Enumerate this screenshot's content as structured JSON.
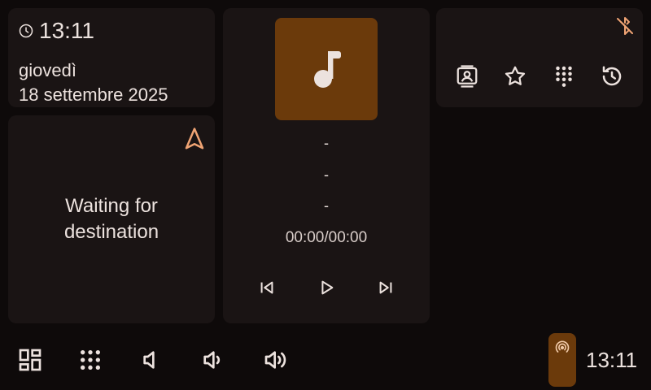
{
  "clock_widget": {
    "time": "13:11",
    "day": "giovedì",
    "date": "18 settembre 2025",
    "icon": "clock-icon"
  },
  "navigation": {
    "message": "Waiting for destination",
    "icon": "navigation-arrow-icon",
    "accent": "#f0a474"
  },
  "media": {
    "title": "-",
    "artist": "-",
    "album": "-",
    "time": "00:00/00:00",
    "art_color": "#6b3a0b",
    "icons": [
      "music-note-icon",
      "skip-previous-icon",
      "play-icon",
      "skip-next-icon"
    ]
  },
  "phone": {
    "bluetooth_status_icon": "bluetooth-disabled-icon",
    "actions": [
      "contacts-icon",
      "favorites-star-icon",
      "dialpad-icon",
      "call-history-icon"
    ]
  },
  "bottom_bar": {
    "time": "13:11",
    "buttons": [
      "app-grid-icon",
      "dialpad-icon",
      "volume-mute-icon",
      "volume-down-icon",
      "volume-up-icon",
      "radio-signal-icon"
    ]
  },
  "colors": {
    "background": "#0e0a0a",
    "card": "#1a1414",
    "accent": "#f0a474",
    "accent_fill": "#6b3a0b",
    "text": "#ece2de"
  }
}
